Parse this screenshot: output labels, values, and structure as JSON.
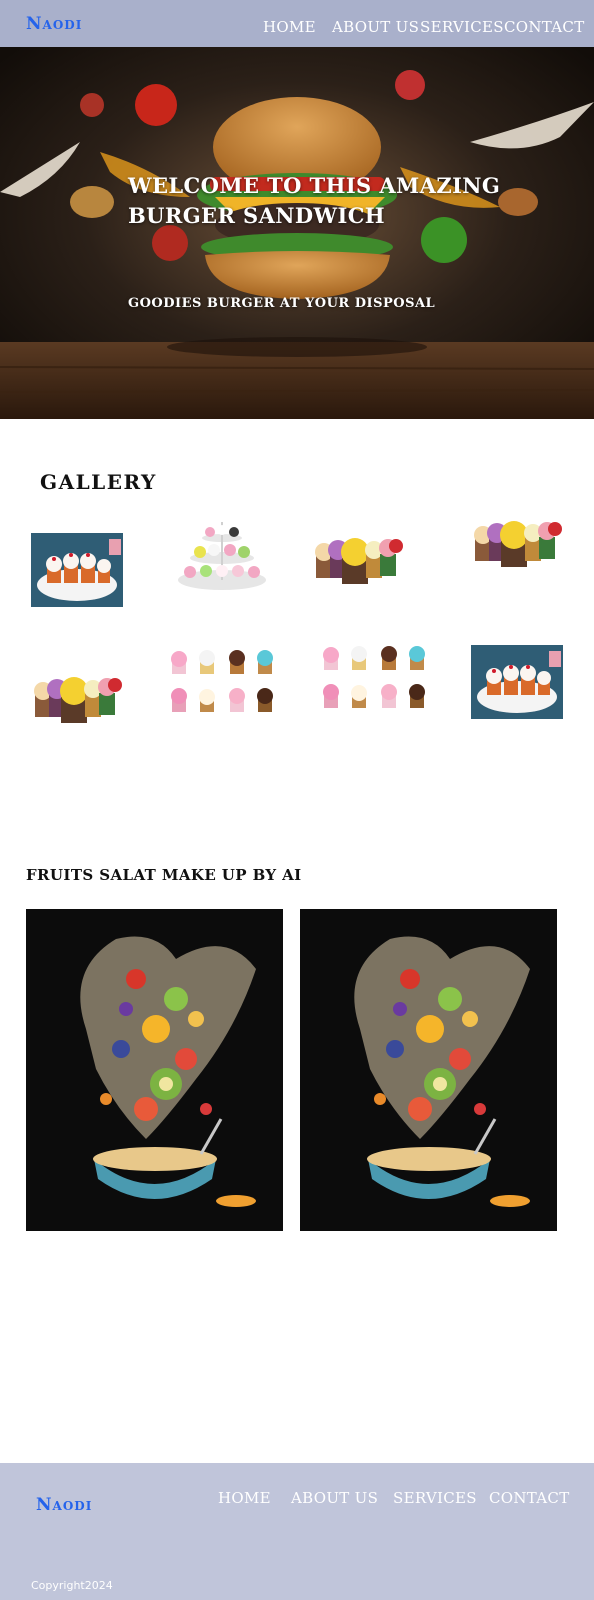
{
  "header": {
    "brand": "Naodi",
    "nav": [
      "HOME",
      "ABOUT US",
      "SERVICES",
      "CONTACT"
    ]
  },
  "hero": {
    "title": "WELCOME TO THIS AMAZING BURGER SANDWICH",
    "subtitle": "GOODIES BURGER AT YOUR DISPOSAL",
    "image_subject": "burger with flying vegetables on wooden table"
  },
  "gallery": {
    "title": "GALLERY",
    "images": [
      "cupcakes-on-plate",
      "cupcake-stand",
      "cupcakes-row",
      "cupcakes-row",
      "cupcakes-row",
      "cupcake-grid",
      "cupcake-grid",
      "cupcakes-on-plate"
    ]
  },
  "fruits": {
    "title": "FRUITS SALAT MAKE UP BY AI",
    "images": [
      "fruit-salad-splash",
      "fruit-salad-splash"
    ]
  },
  "footer": {
    "brand": "Naodi",
    "nav": [
      "HOME",
      "ABOUT US",
      "SERVICES",
      "CONTACT"
    ],
    "copyright": "Copyright2024"
  },
  "colors": {
    "header_bg": "#a9b0cb",
    "footer_bg": "#c0c5da",
    "brand": "#2563eb"
  }
}
